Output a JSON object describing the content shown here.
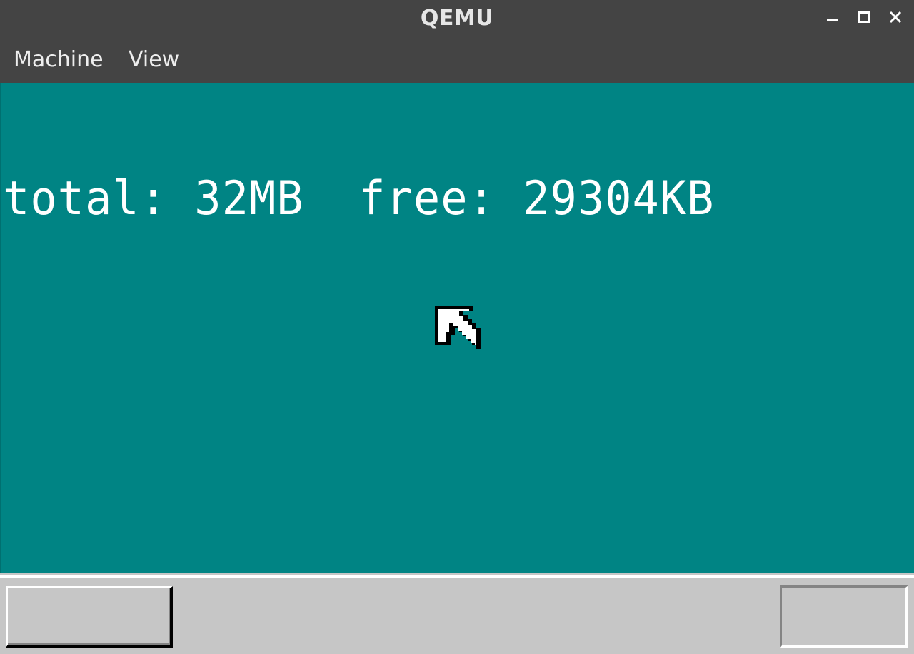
{
  "window": {
    "title": "QEMU"
  },
  "window_controls": {
    "minimize": "minimize-icon",
    "maximize": "maximize-icon",
    "close": "close-icon"
  },
  "menubar": {
    "items": [
      {
        "label": "Machine"
      },
      {
        "label": "View"
      }
    ]
  },
  "guest": {
    "background_color": "#008484",
    "memory_line": "total: 32MB  free: 29304KB",
    "cursor_icon": "mouse-pointer-arrow-icon"
  },
  "taskbar": {
    "background_color": "#c6c6c6",
    "start_button_label": "",
    "tray_text": ""
  },
  "colors": {
    "chrome": "#444444",
    "chrome_text": "#e6e6e6",
    "guest_text": "#ffffff"
  }
}
